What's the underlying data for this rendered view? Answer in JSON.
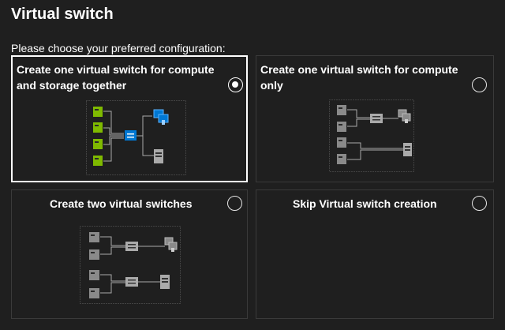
{
  "header": {
    "title": "Virtual switch",
    "subtitle": "Please choose your preferred configuration:"
  },
  "options": [
    {
      "line1": "Create one virtual switch for compute",
      "line2": "and storage together",
      "selected": true
    },
    {
      "line1": "Create one virtual switch for compute",
      "line2": "only",
      "selected": false
    },
    {
      "line1": "Create two virtual switches",
      "selected": false
    },
    {
      "line1": "Skip Virtual switch creation",
      "selected": false
    }
  ],
  "colors": {
    "background": "#1f1f1f",
    "selected_border": "#ffffff",
    "card_border": "#3a3a3a",
    "server_green": "#7fba00",
    "switch_blue": "#0078d4",
    "gray_icon": "#8a8a8a"
  },
  "icons": [
    "server-icon",
    "network-switch-icon",
    "virtual-machines-icon",
    "storage-icon"
  ]
}
